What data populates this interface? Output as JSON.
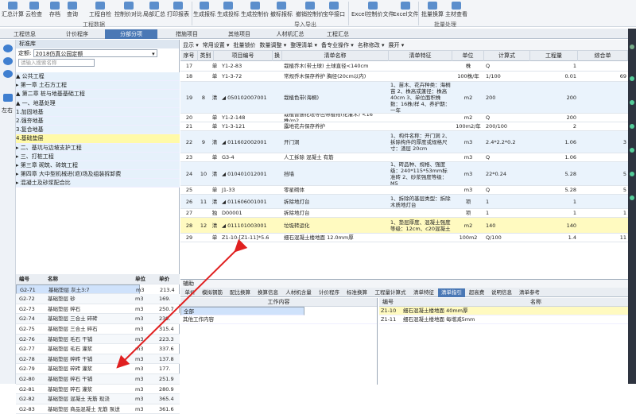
{
  "ribbon": {
    "buttons": [
      "汇总计算",
      "云检查",
      "存档",
      "查询",
      "工程自检",
      "控制价对比",
      "局部汇总",
      "打印报表",
      "生成报标",
      "生成投标",
      "生成控制价",
      "撤标报标",
      "撤销控制价",
      "宝华接口",
      "Excel控制价文件",
      "Excel文件",
      "批量换算",
      "主材查看"
    ],
    "groups": [
      "工程数据",
      "导入导出",
      "批量处理"
    ],
    "counter": "2"
  },
  "tabs": [
    "工程信息",
    "计价程序",
    "分部分项",
    "措施项目",
    "其他项目",
    "人材机汇总",
    "工程汇总"
  ],
  "active_tab": "分部分项",
  "left_nav": {
    "labels": [
      "左右"
    ]
  },
  "library": {
    "title": "标准库",
    "quota_label": "定额:",
    "quota_value": "2018仿真公园定额",
    "search_placeholder": "请输入搜索名称",
    "tree": [
      {
        "text": "▲ 公共工程",
        "hl": false
      },
      {
        "text": "  ▸ 第一章 土石方工程",
        "hl": false
      },
      {
        "text": "  ▲ 第二章 桩与地基基础工程",
        "hl": false
      },
      {
        "text": "    ▲ 一、地基处理",
        "hl": false
      },
      {
        "text": "       1.加固地基",
        "hl": false
      },
      {
        "text": "       2.强夯地基",
        "hl": false
      },
      {
        "text": "       3.复合地基",
        "hl": false
      },
      {
        "text": "       4.基础垫层",
        "hl": true
      },
      {
        "text": "    ▸ 二、基坑与边坡支护工程",
        "hl": false
      },
      {
        "text": "    ▸ 三、打桩工程",
        "hl": false
      },
      {
        "text": "  ▸ 第三章 砌筑、砖筑工程",
        "hl": false
      },
      {
        "text": "  ▸ 第四章 大中型机械进(退)场及组装拆卸费",
        "hl": false
      },
      {
        "text": "▸ 混凝土及砂浆配合比",
        "hl": false
      }
    ],
    "columns": [
      "编号",
      "名称",
      "单位",
      "单价"
    ],
    "rows": [
      [
        "G2-71",
        "基础垫层 灰土3:7",
        "m3",
        "213.4"
      ],
      [
        "G2-72",
        "基础垫层 砂",
        "m3",
        "169."
      ],
      [
        "G2-73",
        "基础垫层 碎石",
        "m3",
        "250.7"
      ],
      [
        "G2-74",
        "基础垫层 三合土 碎砖",
        "m3",
        "239."
      ],
      [
        "G2-75",
        "基础垫层 三合土 碎石",
        "m3",
        "315.4"
      ],
      [
        "G2-76",
        "基础垫层 毛石 干铺",
        "m3",
        "223.3"
      ],
      [
        "G2-77",
        "基础垫层 毛石 灌浆",
        "m3",
        "337.6"
      ],
      [
        "G2-78",
        "基础垫层 碎砖 干铺",
        "m3",
        "137.8"
      ],
      [
        "G2-79",
        "基础垫层 碎砖 灌浆",
        "m3",
        "177."
      ],
      [
        "G2-80",
        "基础垫层 碎石 干铺",
        "m3",
        "251.9"
      ],
      [
        "G2-81",
        "基础垫层 碎石 灌浆",
        "m3",
        "280.9"
      ],
      [
        "G2-82",
        "基础垫层 混凝土 无筋 现浇",
        "m3",
        "365.4"
      ],
      [
        "G2-83",
        "基础垫层 商品混凝土 无筋 泵送",
        "m3",
        "361.6"
      ]
    ]
  },
  "main": {
    "toolbar": [
      "显示 ▾",
      "常用设置 ▾",
      "批量锁价",
      "数量调整 ▾",
      "整理清单 ▾",
      "备专业操作 ▾",
      "名称修改 ▾",
      "展开 ▾"
    ],
    "columns": [
      "序号",
      "类别",
      "项目编号",
      "换",
      "清单名称",
      "清单特征",
      "单位",
      "计算式",
      "工程量",
      "综合单"
    ],
    "rows": [
      {
        "no": "17",
        "seq": "",
        "type": "单",
        "code": "Y1-2-83",
        "name": "栽植乔木(带土球) 土球直径<140cm",
        "feat": "",
        "unit": "株",
        "formula": "Q",
        "qty": "1",
        "price": "",
        "style": "white",
        "h": 13
      },
      {
        "no": "18",
        "seq": "",
        "type": "单",
        "code": "Y1-3-72",
        "name": "常规乔木保存养护 胸径(20cm以内)",
        "feat": "",
        "unit": "100株/年",
        "formula": "1/100",
        "qty": "0.01",
        "price": "69",
        "style": "white",
        "h": 13
      },
      {
        "no": "19",
        "seq": "8",
        "type": "清",
        "code": "◢ 050102007001",
        "name": "栽植色带(海桐)",
        "feat": "1、苗木、花卉种类：海桐苗 2、株高或蓬径：株高40cm 3、单位面积株数：16株/样 4、养护期：一年",
        "unit": "m2",
        "formula": "200",
        "qty": "200",
        "price": "",
        "style": "blue",
        "h": 40
      },
      {
        "no": "20",
        "seq": "",
        "type": "单",
        "code": "Y1-2-148",
        "name": "栽植普通花坛等色带植物(花灌木) <16株/m2",
        "feat": "",
        "unit": "m2",
        "formula": "Q",
        "qty": "200",
        "price": "",
        "style": "white",
        "h": 11
      },
      {
        "no": "21",
        "seq": "",
        "type": "单",
        "code": "Y1-3-121",
        "name": "露地花卉保存养护",
        "feat": "",
        "unit": "100m2/年",
        "formula": "200/100",
        "qty": "2",
        "price": "",
        "style": "white",
        "h": 11
      },
      {
        "no": "22",
        "seq": "9",
        "type": "清",
        "code": "◢ 011602002001",
        "name": "开门洞",
        "feat": "1、构件名称：开门洞 2、拆除构件的厚度或规格尺寸：渣层 20cm",
        "unit": "m3",
        "formula": "2.4*2.2*0.2",
        "qty": "1.06",
        "price": "3",
        "style": "blue",
        "h": 28
      },
      {
        "no": "23",
        "seq": "",
        "type": "单",
        "code": "G3-4",
        "name": "人工拆除 混凝土 有筋",
        "feat": "",
        "unit": "m3",
        "formula": "Q",
        "qty": "1.06",
        "price": "",
        "style": "white",
        "h": 11
      },
      {
        "no": "24",
        "seq": "10",
        "type": "清",
        "code": "◢ 010401012001",
        "name": "挡墙",
        "feat": "1、砖品种、规格、强度级：240*115*53mm标准砖 2、砂浆强度等级：M5",
        "unit": "m3",
        "formula": "22*0.24",
        "qty": "5.28",
        "price": "5",
        "style": "blue",
        "h": 30
      },
      {
        "no": "25",
        "seq": "",
        "type": "单",
        "code": "J1-33",
        "name": "零星砌体",
        "feat": "",
        "unit": "m3",
        "formula": "Q",
        "qty": "5.28",
        "price": "5",
        "style": "white",
        "h": 11
      },
      {
        "no": "26",
        "seq": "11",
        "type": "清",
        "code": "◢ 011606001001",
        "name": "拆除地灯台",
        "feat": "1、拆除的基层类型：拆除木质地灯台",
        "unit": "项",
        "formula": "1",
        "qty": "1",
        "price": "",
        "style": "blue",
        "h": 18
      },
      {
        "no": "27",
        "seq": "",
        "type": "独",
        "code": "D00001",
        "name": "拆除地灯台",
        "feat": "",
        "unit": "项",
        "formula": "1",
        "qty": "1",
        "price": "1",
        "style": "white",
        "h": 11
      },
      {
        "no": "28",
        "seq": "12",
        "type": "清",
        "code": "◢ 011101003001",
        "name": "垃圾转运化",
        "feat": "1、垫层厚度、混凝土强度等级：12cm、c20混凝土",
        "unit": "m2",
        "formula": "140",
        "qty": "140",
        "price": "",
        "style": "yellow",
        "h": 20
      },
      {
        "no": "29",
        "seq": "",
        "type": "单",
        "code": "Z1-10-[Z1-11]*5.6",
        "name": "细石混凝土楼地面 12.0mm厚",
        "feat": "",
        "unit": "100m2",
        "formula": "Q/100",
        "qty": "1.4",
        "price": "11",
        "style": "white",
        "h": 11
      }
    ]
  },
  "aux": {
    "title": "辅助",
    "tabs": [
      "单价",
      "模拟钢筋",
      "配比换算",
      "换算信息",
      "人材机含量",
      "计价程序",
      "标准换算",
      "工程量计算式",
      "清单特征",
      "清单指引",
      "超高费",
      "说明信息",
      "清单参考"
    ],
    "active_tab": "清单指引",
    "work_head": "工作内容",
    "work_rows": [
      "全部",
      "其他工作内容"
    ],
    "sub_head": [
      "编号",
      "名称"
    ],
    "sub_rows": [
      [
        "Z1-10",
        "细石混凝土楼地面 40mm厚"
      ],
      [
        "Z1-11",
        "细石混凝土楼地面 每增减5mm"
      ]
    ]
  },
  "colors": {
    "accent": "#4a78b5",
    "highlight": "#fffac0",
    "arrow": "#e02020"
  }
}
